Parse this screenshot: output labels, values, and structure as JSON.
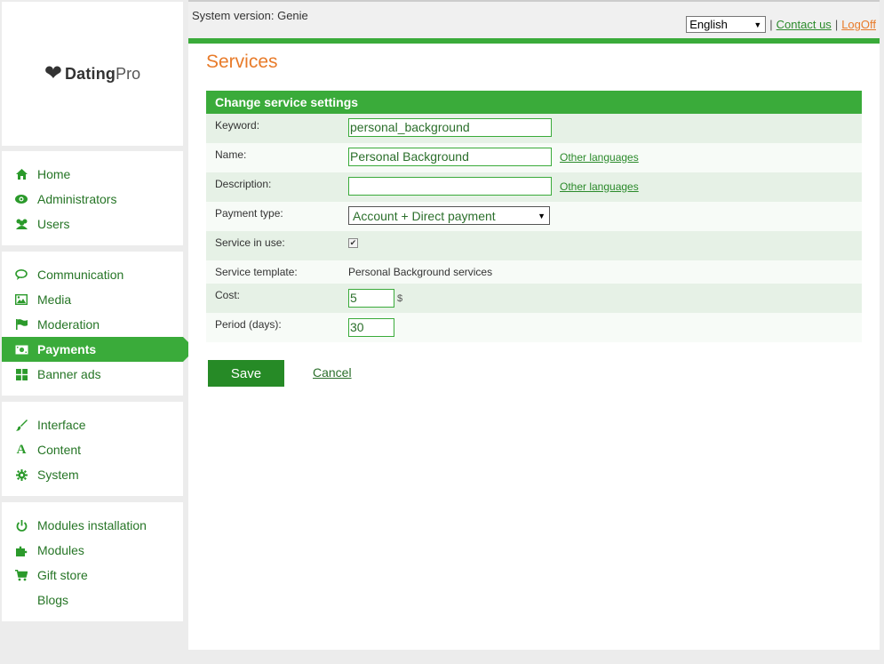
{
  "brand": {
    "name_bold": "Dating",
    "name_thin": "Pro"
  },
  "header": {
    "system_version": "System version: Genie",
    "language": "English",
    "separator": "|",
    "contact": "Contact us",
    "logoff": "LogOff"
  },
  "nav": {
    "group1": [
      {
        "label": "Home",
        "icon": "home-icon"
      },
      {
        "label": "Administrators",
        "icon": "eye-icon"
      },
      {
        "label": "Users",
        "icon": "users-icon"
      }
    ],
    "group2": [
      {
        "label": "Communication",
        "icon": "chat-icon"
      },
      {
        "label": "Media",
        "icon": "image-icon"
      },
      {
        "label": "Moderation",
        "icon": "flag-icon"
      },
      {
        "label": "Payments",
        "icon": "money-icon",
        "active": true
      },
      {
        "label": "Banner ads",
        "icon": "grid-icon"
      }
    ],
    "group3": [
      {
        "label": "Interface",
        "icon": "brush-icon"
      },
      {
        "label": "Content",
        "icon": "font-icon"
      },
      {
        "label": "System",
        "icon": "gear-icon"
      }
    ],
    "group4": [
      {
        "label": "Modules installation",
        "icon": "power-icon"
      },
      {
        "label": "Modules",
        "icon": "puzzle-icon"
      },
      {
        "label": "Gift store",
        "icon": "cart-icon"
      },
      {
        "label": "Blogs",
        "icon": ""
      }
    ]
  },
  "page": {
    "title": "Services",
    "panel_title": "Change service settings",
    "fields": {
      "keyword": {
        "label": "Keyword:",
        "value": "personal_background"
      },
      "name": {
        "label": "Name:",
        "value": "Personal Background",
        "link": "Other languages"
      },
      "description": {
        "label": "Description:",
        "value": "",
        "link": "Other languages"
      },
      "payment_type": {
        "label": "Payment type:",
        "value": "Account + Direct payment"
      },
      "in_use": {
        "label": "Service in use:",
        "checked": true
      },
      "template": {
        "label": "Service template:",
        "value": "Personal Background services"
      },
      "cost": {
        "label": "Cost:",
        "value": "5",
        "unit": "$"
      },
      "period": {
        "label": "Period (days):",
        "value": "30"
      }
    },
    "save": "Save",
    "cancel": "Cancel"
  },
  "colors": {
    "accent": "#3aab3a",
    "title": "#e87b2a",
    "link": "#2b8a2b"
  }
}
